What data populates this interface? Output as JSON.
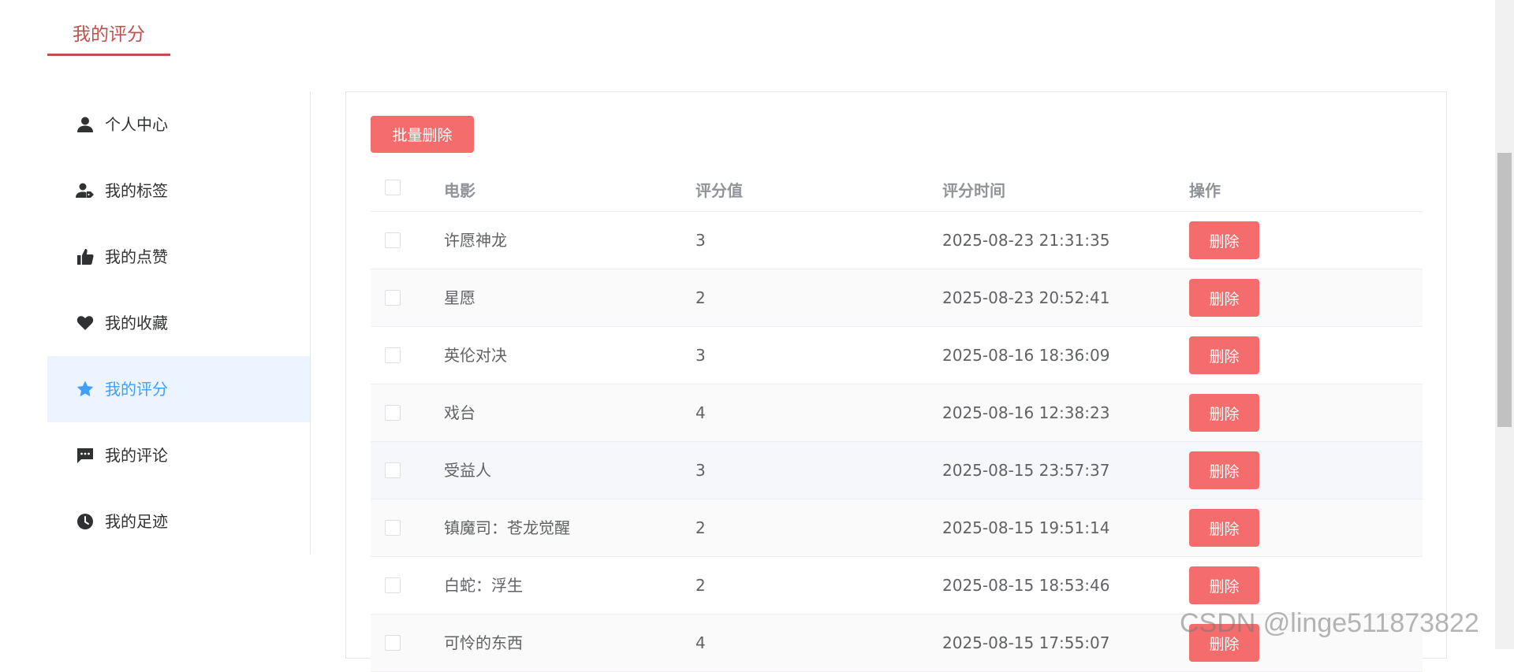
{
  "page_title": "我的评分",
  "sidebar": {
    "items": [
      {
        "label": "个人中心",
        "icon": "user-icon",
        "active": false
      },
      {
        "label": "我的标签",
        "icon": "user-tag-icon",
        "active": false
      },
      {
        "label": "我的点赞",
        "icon": "thumbs-up-icon",
        "active": false
      },
      {
        "label": "我的收藏",
        "icon": "heart-icon",
        "active": false
      },
      {
        "label": "我的评分",
        "icon": "star-icon",
        "active": true
      },
      {
        "label": "我的评论",
        "icon": "comment-icon",
        "active": false
      },
      {
        "label": "我的足迹",
        "icon": "clock-icon",
        "active": false
      }
    ]
  },
  "toolbar": {
    "bulk_delete_label": "批量删除"
  },
  "table": {
    "headers": {
      "movie": "电影",
      "score": "评分值",
      "time": "评分时间",
      "op": "操作"
    },
    "delete_label": "删除",
    "rows": [
      {
        "movie": "许愿神龙",
        "score": "3",
        "time": "2025-08-23 21:31:35"
      },
      {
        "movie": "星愿",
        "score": "2",
        "time": "2025-08-23 20:52:41"
      },
      {
        "movie": "英伦对决",
        "score": "3",
        "time": "2025-08-16 18:36:09"
      },
      {
        "movie": "戏台",
        "score": "4",
        "time": "2025-08-16 12:38:23"
      },
      {
        "movie": "受益人",
        "score": "3",
        "time": "2025-08-15 23:57:37"
      },
      {
        "movie": "镇魔司：苍龙觉醒",
        "score": "2",
        "time": "2025-08-15 19:51:14"
      },
      {
        "movie": "白蛇：浮生",
        "score": "2",
        "time": "2025-08-15 18:53:46"
      },
      {
        "movie": "可怜的东西",
        "score": "4",
        "time": "2025-08-15 17:55:07"
      }
    ]
  },
  "watermark": "CSDN @linge511873822",
  "colors": {
    "accent_red": "#c0504d",
    "danger": "#f56c6c",
    "active_blue": "#409eff",
    "active_bg": "#ecf5ff"
  }
}
